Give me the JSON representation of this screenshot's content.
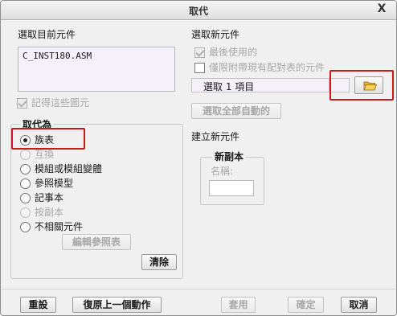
{
  "window": {
    "title": "取代",
    "close_glyph": "X"
  },
  "left": {
    "section_title": "選取目前元件",
    "list_items": [
      "C_INST180.ASM"
    ],
    "remember_label": "記得這些圖元",
    "remember_checked": true,
    "replace_by": {
      "title": "取代為",
      "options": [
        {
          "label": "族表",
          "selected": true,
          "enabled": true
        },
        {
          "label": "互換",
          "selected": false,
          "enabled": false
        },
        {
          "label": "模組或模組變體",
          "selected": false,
          "enabled": true
        },
        {
          "label": "參照模型",
          "selected": false,
          "enabled": true
        },
        {
          "label": "記事本",
          "selected": false,
          "enabled": true
        },
        {
          "label": "按副本",
          "selected": false,
          "enabled": false
        },
        {
          "label": "不相關元件",
          "selected": false,
          "enabled": true
        }
      ],
      "edit_ref_table_label": "編輯參照表",
      "clear_label": "清除"
    }
  },
  "right": {
    "section_title": "選取新元件",
    "last_used_label": "最後使用的",
    "with_table_only_label": "僅限附帶現有配對表的元件",
    "selection_field": "選取 1 項目",
    "select_all_auto_label": "選取全部自動的",
    "create_new_title": "建立新元件",
    "new_copy": {
      "title": "新副本",
      "name_label": "名稱:",
      "name_value": ""
    }
  },
  "footer": {
    "reset_label": "重設",
    "undo_label": "復原上一個動作",
    "apply_label": "套用",
    "ok_label": "確定",
    "cancel_label": "取消"
  },
  "colors": {
    "highlight_frame": "#c8191f",
    "field_bg": "#f5f0fa",
    "dialog_bg": "#f0f0f0"
  },
  "icons": [
    "close-icon",
    "folder-open-icon",
    "radio-selected-icon",
    "checkbox-checked-icon"
  ]
}
